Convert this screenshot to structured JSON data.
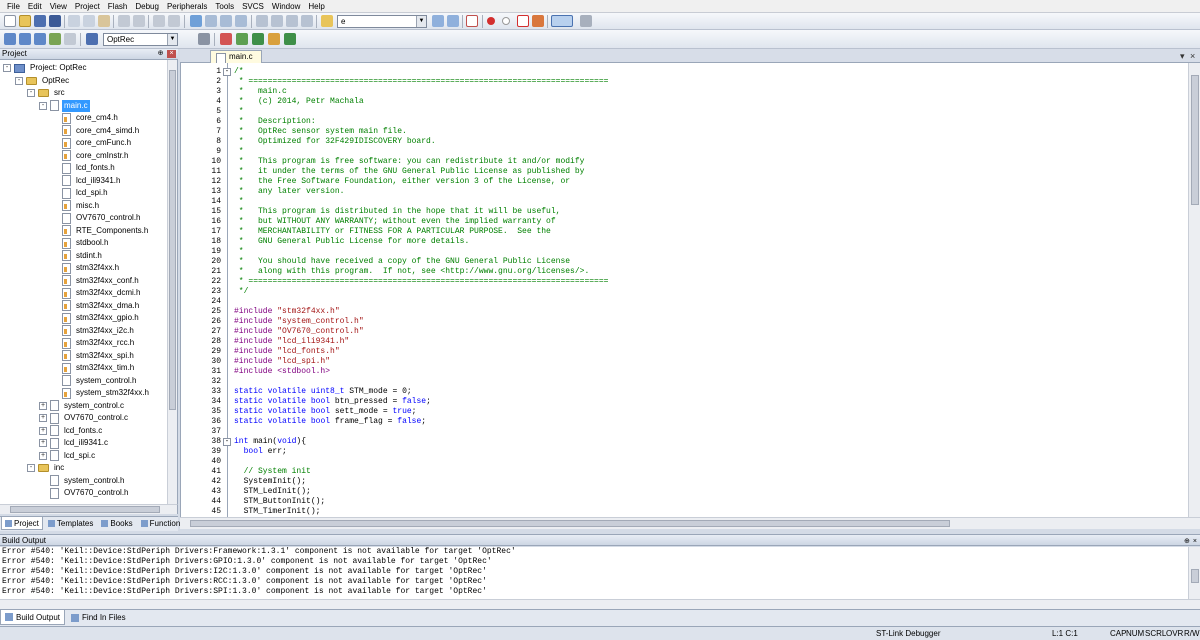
{
  "menu": [
    "File",
    "Edit",
    "View",
    "Project",
    "Flash",
    "Debug",
    "Peripherals",
    "Tools",
    "SVCS",
    "Window",
    "Help"
  ],
  "toolbar": {
    "find_value": "e",
    "target_value": "OptRec"
  },
  "project_panel": {
    "title": "Project",
    "tree": [
      {
        "label": "Project: OptRec",
        "level": 0,
        "kind": "project",
        "exp": "-"
      },
      {
        "label": "OptRec",
        "level": 1,
        "kind": "folder",
        "exp": "-"
      },
      {
        "label": "src",
        "level": 2,
        "kind": "folder",
        "exp": "-"
      },
      {
        "label": "main.c",
        "level": 3,
        "kind": "file",
        "exp": "-",
        "selected": true
      },
      {
        "label": "core_cm4.h",
        "level": 4,
        "kind": "hfile"
      },
      {
        "label": "core_cm4_simd.h",
        "level": 4,
        "kind": "hfile"
      },
      {
        "label": "core_cmFunc.h",
        "level": 4,
        "kind": "hfile"
      },
      {
        "label": "core_cmInstr.h",
        "level": 4,
        "kind": "hfile"
      },
      {
        "label": "lcd_fonts.h",
        "level": 4,
        "kind": "file"
      },
      {
        "label": "lcd_ili9341.h",
        "level": 4,
        "kind": "file"
      },
      {
        "label": "lcd_spi.h",
        "level": 4,
        "kind": "file"
      },
      {
        "label": "misc.h",
        "level": 4,
        "kind": "hfile"
      },
      {
        "label": "OV7670_control.h",
        "level": 4,
        "kind": "file"
      },
      {
        "label": "RTE_Components.h",
        "level": 4,
        "kind": "hfile"
      },
      {
        "label": "stdbool.h",
        "level": 4,
        "kind": "hfile"
      },
      {
        "label": "stdint.h",
        "level": 4,
        "kind": "hfile"
      },
      {
        "label": "stm32f4xx.h",
        "level": 4,
        "kind": "hfile"
      },
      {
        "label": "stm32f4xx_conf.h",
        "level": 4,
        "kind": "hfile"
      },
      {
        "label": "stm32f4xx_dcmi.h",
        "level": 4,
        "kind": "hfile"
      },
      {
        "label": "stm32f4xx_dma.h",
        "level": 4,
        "kind": "hfile"
      },
      {
        "label": "stm32f4xx_gpio.h",
        "level": 4,
        "kind": "hfile"
      },
      {
        "label": "stm32f4xx_i2c.h",
        "level": 4,
        "kind": "hfile"
      },
      {
        "label": "stm32f4xx_rcc.h",
        "level": 4,
        "kind": "hfile"
      },
      {
        "label": "stm32f4xx_spi.h",
        "level": 4,
        "kind": "hfile"
      },
      {
        "label": "stm32f4xx_tim.h",
        "level": 4,
        "kind": "hfile"
      },
      {
        "label": "system_control.h",
        "level": 4,
        "kind": "file"
      },
      {
        "label": "system_stm32f4xx.h",
        "level": 4,
        "kind": "hfile"
      },
      {
        "label": "system_control.c",
        "level": 3,
        "kind": "file",
        "exp": "+"
      },
      {
        "label": "OV7670_control.c",
        "level": 3,
        "kind": "file",
        "exp": "+"
      },
      {
        "label": "lcd_fonts.c",
        "level": 3,
        "kind": "file",
        "exp": "+"
      },
      {
        "label": "lcd_ili9341.c",
        "level": 3,
        "kind": "file",
        "exp": "+"
      },
      {
        "label": "lcd_spi.c",
        "level": 3,
        "kind": "file",
        "exp": "+"
      },
      {
        "label": "inc",
        "level": 2,
        "kind": "folder",
        "exp": "-"
      },
      {
        "label": "system_control.h",
        "level": 3,
        "kind": "file"
      },
      {
        "label": "OV7670_control.h",
        "level": 3,
        "kind": "file"
      }
    ],
    "tabs": [
      "Project",
      "Templates",
      "Books",
      "Functions"
    ]
  },
  "editor": {
    "tab": "main.c",
    "lines": [
      {
        "n": "1",
        "t": "/*",
        "c": "comment",
        "fold": "-"
      },
      {
        "n": "2",
        "t": " * ===========================================================================",
        "c": "comment"
      },
      {
        "n": "3",
        "t": " *   main.c",
        "c": "comment"
      },
      {
        "n": "4",
        "t": " *   (c) 2014, Petr Machala",
        "c": "comment"
      },
      {
        "n": "5",
        "t": " *",
        "c": "comment"
      },
      {
        "n": "6",
        "t": " *   Description:",
        "c": "comment"
      },
      {
        "n": "7",
        "t": " *   OptRec sensor system main file.",
        "c": "comment"
      },
      {
        "n": "8",
        "t": " *   Optimized for 32F429IDISCOVERY board.",
        "c": "comment"
      },
      {
        "n": "9",
        "t": " *",
        "c": "comment"
      },
      {
        "n": "10",
        "t": " *   This program is free software: you can redistribute it and/or modify",
        "c": "comment"
      },
      {
        "n": "11",
        "t": " *   it under the terms of the GNU General Public License as published by",
        "c": "comment"
      },
      {
        "n": "12",
        "t": " *   the Free Software Foundation, either version 3 of the License, or",
        "c": "comment"
      },
      {
        "n": "13",
        "t": " *   any later version.",
        "c": "comment"
      },
      {
        "n": "14",
        "t": " *",
        "c": "comment"
      },
      {
        "n": "15",
        "t": " *   This program is distributed in the hope that it will be useful,",
        "c": "comment"
      },
      {
        "n": "16",
        "t": " *   but WITHOUT ANY WARRANTY; without even the implied warranty of",
        "c": "comment"
      },
      {
        "n": "17",
        "t": " *   MERCHANTABILITY or FITNESS FOR A PARTICULAR PURPOSE.  See the",
        "c": "comment"
      },
      {
        "n": "18",
        "t": " *   GNU General Public License for more details.",
        "c": "comment"
      },
      {
        "n": "19",
        "t": " *",
        "c": "comment"
      },
      {
        "n": "20",
        "t": " *   You should have received a copy of the GNU General Public License",
        "c": "comment"
      },
      {
        "n": "21",
        "t": " *   along with this program.  If not, see <http://www.gnu.org/licenses/>.",
        "c": "comment"
      },
      {
        "n": "22",
        "t": " * ===========================================================================",
        "c": "comment"
      },
      {
        "n": "23",
        "t": " */",
        "c": "comment"
      },
      {
        "n": "24",
        "t": "",
        "c": "plain"
      },
      {
        "n": "25",
        "t": "#include \"stm32f4xx.h\"",
        "c": "pre"
      },
      {
        "n": "26",
        "t": "#include \"system_control.h\"",
        "c": "pre"
      },
      {
        "n": "27",
        "t": "#include \"OV7670_control.h\"",
        "c": "pre"
      },
      {
        "n": "28",
        "t": "#include \"lcd_ili9341.h\"",
        "c": "pre"
      },
      {
        "n": "29",
        "t": "#include \"lcd_fonts.h\"",
        "c": "pre"
      },
      {
        "n": "30",
        "t": "#include \"lcd_spi.h\"",
        "c": "pre"
      },
      {
        "n": "31",
        "t": "#include <stdbool.h>",
        "c": "pre"
      },
      {
        "n": "32",
        "t": "",
        "c": "plain"
      },
      {
        "n": "33",
        "t": "static volatile uint8_t STM_mode = 0;",
        "c": "plain"
      },
      {
        "n": "34",
        "t": "static volatile bool btn_pressed = false;",
        "c": "plain"
      },
      {
        "n": "35",
        "t": "static volatile bool sett_mode = true;",
        "c": "plain"
      },
      {
        "n": "36",
        "t": "static volatile bool frame_flag = false;",
        "c": "plain"
      },
      {
        "n": "37",
        "t": "",
        "c": "plain"
      },
      {
        "n": "38",
        "t": "int main(void){",
        "c": "plain",
        "fold": "-"
      },
      {
        "n": "39",
        "t": "  bool err;",
        "c": "plain"
      },
      {
        "n": "40",
        "t": "",
        "c": "plain"
      },
      {
        "n": "41",
        "t": "  // System init",
        "c": "comment"
      },
      {
        "n": "42",
        "t": "  SystemInit();",
        "c": "plain"
      },
      {
        "n": "43",
        "t": "  STM_LedInit();",
        "c": "plain"
      },
      {
        "n": "44",
        "t": "  STM_ButtonInit();",
        "c": "plain"
      },
      {
        "n": "45",
        "t": "  STM_TimerInit();",
        "c": "plain"
      }
    ]
  },
  "build_output": {
    "title": "Build Output",
    "lines": [
      "Error #540: 'Keil::Device:StdPeriph Drivers:Framework:1.3.1' component is not available for target 'OptRec'",
      "Error #540: 'Keil::Device:StdPeriph Drivers:GPIO:1.3.0' component is not available for target 'OptRec'",
      "Error #540: 'Keil::Device:StdPeriph Drivers:I2C:1.3.0' component is not available for target 'OptRec'",
      "Error #540: 'Keil::Device:StdPeriph Drivers:RCC:1.3.0' component is not available for target 'OptRec'",
      "Error #540: 'Keil::Device:StdPeriph Drivers:SPI:1.3.0' component is not available for target 'OptRec'"
    ],
    "tabs": [
      "Build Output",
      "Find In Files"
    ]
  },
  "status": {
    "debugger": "ST-Link Debugger",
    "position": "L:1 C:1",
    "keys": [
      "CAP",
      "NUM",
      "SCRL",
      "OVR",
      "R/W"
    ]
  }
}
